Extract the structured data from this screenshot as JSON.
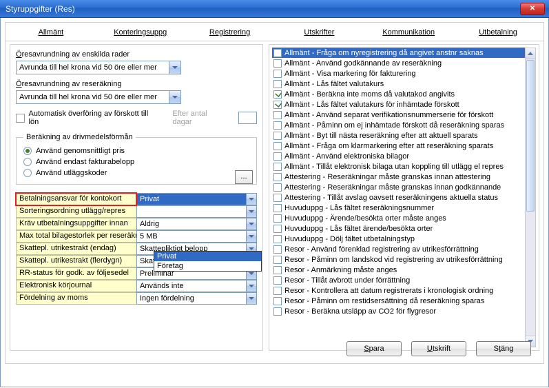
{
  "window": {
    "title": "Styruppgifter (Res)"
  },
  "tabs": [
    {
      "label": "Allmänt",
      "accel": 0
    },
    {
      "label": "Konteringsuppg",
      "accel": 0
    },
    {
      "label": "Registrering",
      "accel": 0
    },
    {
      "label": "Utskrifter",
      "accel": 0
    },
    {
      "label": "Kommunikation",
      "accel": 0
    },
    {
      "label": "Utbetalning",
      "accel": 0
    }
  ],
  "left": {
    "oresavr_rader_label": "Öresavrundning av enskilda rader",
    "oresavr_rader_value": "Avrunda till hel krona vid 50 öre eller mer",
    "oresavr_reserak_label": "Öresavrundning av reseräkning",
    "oresavr_reserak_value": "Avrunda till hel krona vid 50 öre eller mer",
    "auto_forskott_label": "Automatisk överföring av förskott till lön",
    "auto_forskott_checked": false,
    "efter_antal_dagar_label": "Efter antal dagar",
    "drivmedel_legend": "Beräkning av drivmedelsförmån",
    "drivmedel_options": [
      {
        "label": "Använd genomsnittligt pris",
        "checked": true
      },
      {
        "label": "Använd endast fakturabelopp",
        "checked": false
      },
      {
        "label": "Använd utläggskoder",
        "checked": false
      }
    ],
    "dots": "...",
    "props": [
      {
        "label": "Betalningsansvar för kontokort",
        "value": "Privat",
        "open": true,
        "highlight": true
      },
      {
        "label": "Sorteringsordning utlägg/repres",
        "value": ""
      },
      {
        "label": "Kräv utbetalningsuppgifter innan",
        "value": "Aldrig"
      },
      {
        "label": "Max total bilagestorlek per reseräkn",
        "value": "5 MB"
      },
      {
        "label": "Skattepl. utrikestrakt (endag)",
        "value": "Skattepliktigt belopp"
      },
      {
        "label": "Skattepl. utrikestrakt (flerdygn)",
        "value": "Skattepliktigt belopp"
      },
      {
        "label": "RR-status för godk. av följesedel",
        "value": "Preliminär"
      },
      {
        "label": "Elektronisk körjournal",
        "value": "Används inte"
      },
      {
        "label": "Fördelning av moms",
        "value": "Ingen fördelning"
      }
    ],
    "dropdown_options": [
      "Privat",
      "Företag"
    ]
  },
  "right": {
    "items": [
      {
        "label": "Allmänt - Fråga om nyregistrering då angivet anstnr saknas",
        "checked": false,
        "selected": true
      },
      {
        "label": "Allmänt - Använd godkännande av reseräkning",
        "checked": false
      },
      {
        "label": "Allmänt - Visa markering för fakturering",
        "checked": false
      },
      {
        "label": "Allmänt - Lås fältet valutakurs",
        "checked": false
      },
      {
        "label": "Allmänt - Beräkna inte moms då valutakod angivits",
        "checked": true
      },
      {
        "label": "Allmänt - Lås fältet valutakurs för inhämtade förskott",
        "checked": true
      },
      {
        "label": "Allmänt - Använd separat verifikationsnummerserie för förskott",
        "checked": false
      },
      {
        "label": "Allmänt - Påminn om ej inhämtade förskott då reseräkning sparas",
        "checked": false
      },
      {
        "label": "Allmänt - Byt till nästa reseräkning efter att aktuell sparats",
        "checked": false
      },
      {
        "label": "Allmänt - Fråga om klarmarkering efter att reseräkning sparats",
        "checked": false
      },
      {
        "label": "Allmänt - Använd elektroniska bilagor",
        "checked": false
      },
      {
        "label": "Allmänt - Tillåt elektronisk bilaga utan koppling till utlägg el repres",
        "checked": false
      },
      {
        "label": "Attestering - Reseräkningar måste granskas innan attestering",
        "checked": false
      },
      {
        "label": "Attestering - Reseräkningar måste granskas innan godkännande",
        "checked": false
      },
      {
        "label": "Attestering - Tillåt avslag oavsett reseräkningens aktuella status",
        "checked": false
      },
      {
        "label": "Huvuduppg - Lås fältet reseräkningsnummer",
        "checked": false
      },
      {
        "label": "Huvuduppg - Ärende/besökta orter måste anges",
        "checked": false
      },
      {
        "label": "Huvuduppg - Lås fältet ärende/besökta orter",
        "checked": false
      },
      {
        "label": "Huvuduppg - Dölj fältet utbetalningstyp",
        "checked": false
      },
      {
        "label": "Resor - Använd förenklad registrering av utrikesförrättning",
        "checked": false
      },
      {
        "label": "Resor - Påminn om landskod vid registrering av utrikesförrättning",
        "checked": false
      },
      {
        "label": "Resor - Anmärkning måste anges",
        "checked": false
      },
      {
        "label": "Resor - Tillåt avbrott under förrättning",
        "checked": false
      },
      {
        "label": "Resor - Kontrollera att datum registrerats i kronologisk ordning",
        "checked": false
      },
      {
        "label": "Resor - Påminn om restidsersättning då reseräkning sparas",
        "checked": false
      },
      {
        "label": "Resor - Beräkna utsläpp av CO2 för flygresor",
        "checked": false
      }
    ]
  },
  "buttons": {
    "save": "Spara",
    "print": "Utskrift",
    "close": "Stäng"
  }
}
